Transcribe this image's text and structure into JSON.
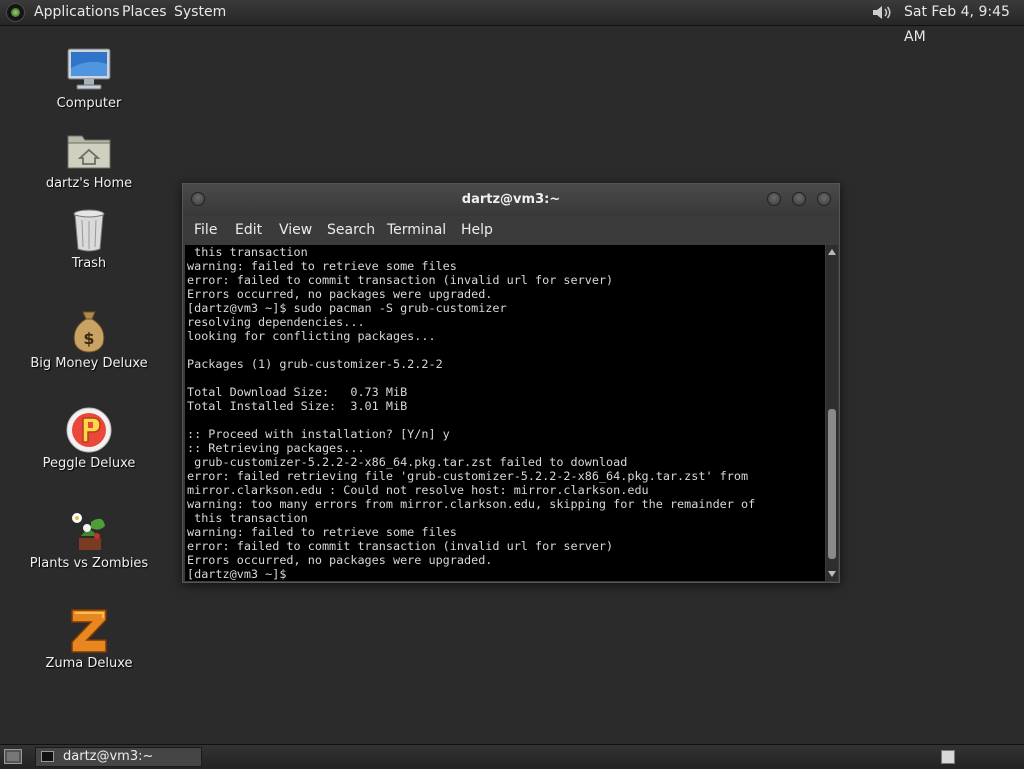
{
  "top_panel": {
    "menus": [
      "Applications",
      "Places",
      "System"
    ],
    "clock": "Sat Feb  4,  9:45 AM"
  },
  "desktop": {
    "icons": [
      {
        "label": "Computer"
      },
      {
        "label": "dartz's Home"
      },
      {
        "label": "Trash"
      },
      {
        "label": "Big Money Deluxe"
      },
      {
        "label": "Peggle Deluxe"
      },
      {
        "label": "Plants vs Zombies"
      },
      {
        "label": "Zuma Deluxe"
      }
    ]
  },
  "terminal": {
    "title": "dartz@vm3:~",
    "menu": [
      "File",
      "Edit",
      "View",
      "Search",
      "Terminal",
      "Help"
    ],
    "scroll_position": 0.95,
    "lines": [
      " this transaction",
      "warning: failed to retrieve some files",
      "error: failed to commit transaction (invalid url for server)",
      "Errors occurred, no packages were upgraded.",
      "[dartz@vm3 ~]$ sudo pacman -S grub-customizer",
      "resolving dependencies...",
      "looking for conflicting packages...",
      "",
      "Packages (1) grub-customizer-5.2.2-2",
      "",
      "Total Download Size:   0.73 MiB",
      "Total Installed Size:  3.01 MiB",
      "",
      ":: Proceed with installation? [Y/n] y",
      ":: Retrieving packages...",
      " grub-customizer-5.2.2-2-x86_64.pkg.tar.zst failed to download",
      "error: failed retrieving file 'grub-customizer-5.2.2-2-x86_64.pkg.tar.zst' from",
      "mirror.clarkson.edu : Could not resolve host: mirror.clarkson.edu",
      "warning: too many errors from mirror.clarkson.edu, skipping for the remainder of",
      " this transaction",
      "warning: failed to retrieve some files",
      "error: failed to commit transaction (invalid url for server)",
      "Errors occurred, no packages were upgraded.",
      "[dartz@vm3 ~]$ "
    ]
  },
  "taskbar": {
    "task_label": "dartz@vm3:~"
  },
  "colors": {
    "desktop_bg": "#2b2b2b",
    "terminal_bg": "#000000",
    "terminal_fg": "#d8d8d8"
  }
}
